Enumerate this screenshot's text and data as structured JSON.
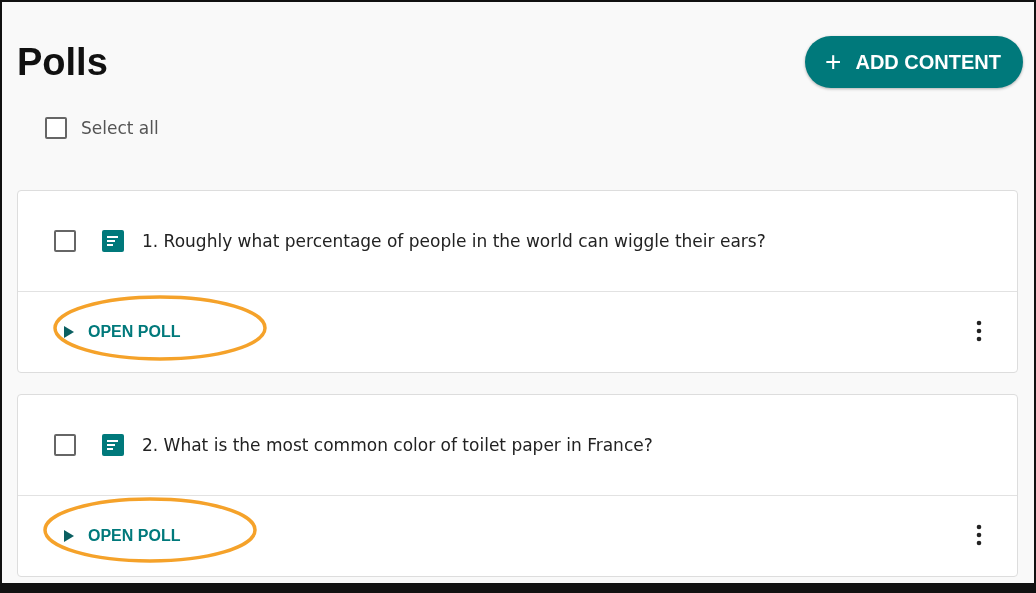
{
  "header": {
    "title": "Polls",
    "add_button": {
      "icon": "+",
      "label": "ADD CONTENT"
    }
  },
  "select_all": {
    "label": "Select all",
    "checked": false
  },
  "polls": [
    {
      "question": "1. Roughly what percentage of people in the world can wiggle their ears?",
      "checked": false,
      "action": "OPEN POLL",
      "highlighted": true
    },
    {
      "question": "2. What is the most common color of toilet paper in France?",
      "checked": false,
      "action": "OPEN POLL",
      "highlighted": true
    }
  ]
}
